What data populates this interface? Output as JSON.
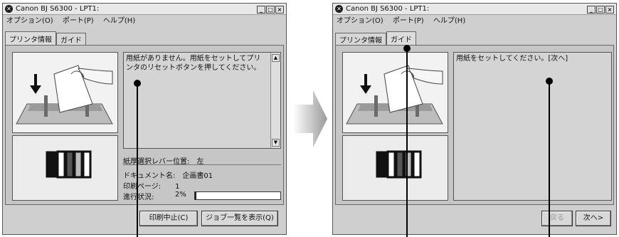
{
  "left_window": {
    "title": "Canon BJ S6300 - LPT1:",
    "menu": [
      "オプション(O)",
      "ポート(P)",
      "ヘルプ(H)"
    ],
    "tabs": [
      "プリンタ情報",
      "ガイド"
    ],
    "active_tab": "プリンタ情報",
    "message": "用紙がありません。用紙をセットしてプリンタのリセットボタンを押してください。",
    "paper_lever": "紙厚選択レバー位置:　左",
    "document_name": "ドキュメント名:　企画書01",
    "printing_page": "印刷ページ:　　1",
    "progress_label": "進行状況:",
    "progress_text": "2%",
    "progress_value": 0.02,
    "buttons": [
      "印刷中止(C)",
      "ジョブ一覧を表示(Q)"
    ]
  },
  "right_window": {
    "title": "Canon BJ S6300 - LPT1:",
    "menu": [
      "オプション(O)",
      "ポート(P)",
      "ヘルプ(H)"
    ],
    "tabs": [
      "プリンタ情報",
      "ガイド"
    ],
    "active_tab": "ガイド",
    "message": "用紙をセットしてください。[次へ]",
    "buttons": [
      "戻る",
      "次へ>"
    ],
    "disabled_button": "戻る"
  },
  "window_controls": [
    "minimize",
    "maximize",
    "close"
  ],
  "icons": [
    "canon-app-icon",
    "minimize-icon",
    "maximize-icon",
    "close-icon",
    "scroll-up-icon",
    "scroll-down-icon",
    "paper-loading-illustration",
    "ink-tanks-icon",
    "transition-arrow-icon"
  ],
  "colors": {
    "window_bg": "#cfcfcf",
    "panel_bg": "#c6c6c6",
    "text": "#111111",
    "pointer": "#000000"
  }
}
